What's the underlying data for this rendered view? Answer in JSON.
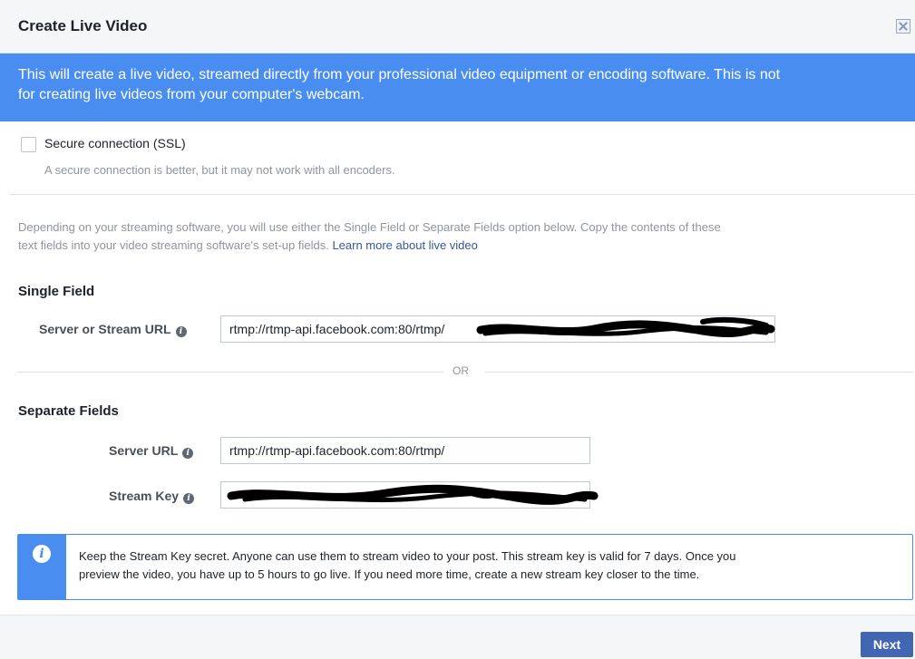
{
  "dialog": {
    "title": "Create Live Video",
    "banner_line1": "This will create a live video, streamed directly from your professional video equipment or encoding software. This is not",
    "banner_line2": "for creating live videos from your computer's webcam."
  },
  "ssl": {
    "label": "Secure connection (SSL)",
    "hint": "A secure connection is better, but it may not work with all encoders.",
    "checked": false
  },
  "description": {
    "line1": "Depending on your streaming software, you will use either the Single Field or Separate Fields option below. Copy the contents of these",
    "line2": "text fields into your video streaming software's set-up fields.",
    "link": "Learn more about live video"
  },
  "single_field": {
    "heading": "Single Field",
    "url_label": "Server or Stream URL",
    "url_value": "rtmp://rtmp-api.facebook.com:80/rtmp/"
  },
  "separator": {
    "text": "OR"
  },
  "separate_fields": {
    "heading": "Separate Fields",
    "server_label": "Server URL",
    "server_value": "rtmp://rtmp-api.facebook.com:80/rtmp/",
    "key_label": "Stream Key",
    "key_value": ""
  },
  "notice": {
    "line1": "Keep the Stream Key secret. Anyone can use them to stream video to your post. This stream key is valid for 7 days. Once you",
    "line2": "preview the video, you have up to 5 hours to go live. If you need more time, create a new stream key closer to the time."
  },
  "footer": {
    "next_label": "Next"
  },
  "colors": {
    "banner_bg": "#4a8df0",
    "primary_button": "#4267b2",
    "link": "#365899"
  },
  "icons": {
    "close": "close-icon",
    "info_small": "info-icon",
    "notice": "info-circle-icon"
  }
}
